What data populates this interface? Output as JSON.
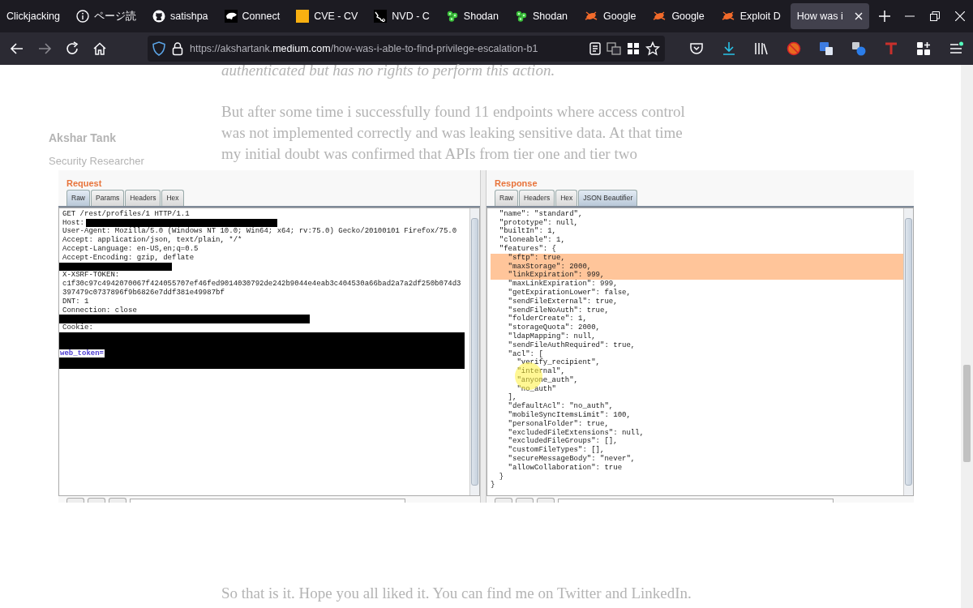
{
  "browser": {
    "tabs": [
      {
        "title": "Clickjacking",
        "kind": "plain",
        "selected": false
      },
      {
        "title": "ページ読",
        "kind": "info",
        "selected": false
      },
      {
        "title": "satishpa",
        "kind": "github",
        "selected": false
      },
      {
        "title": "Connect",
        "kind": "animal",
        "selected": false
      },
      {
        "title": "CVE - CV",
        "kind": "square",
        "selected": false
      },
      {
        "title": "NVD - C",
        "kind": "nvd",
        "selected": false
      },
      {
        "title": "Shodan",
        "kind": "dots",
        "selected": false
      },
      {
        "title": "Shodan",
        "kind": "dots",
        "selected": false
      },
      {
        "title": "Google",
        "kind": "bug",
        "selected": false
      },
      {
        "title": "Google",
        "kind": "bug",
        "selected": false
      },
      {
        "title": "Exploit D",
        "kind": "bug",
        "selected": false
      },
      {
        "title": "How was i",
        "kind": "plain",
        "selected": true
      }
    ],
    "nav_buttons": [
      {
        "kind": "back",
        "disabled": false
      },
      {
        "kind": "forward",
        "disabled": true
      },
      {
        "kind": "reload",
        "disabled": false
      },
      {
        "kind": "home",
        "disabled": false
      }
    ],
    "url": {
      "prefix": "https://akshartank.",
      "domain": "medium.com",
      "path": "/how-was-i-able-to-find-privilege-escalation-b1"
    },
    "menu_update_dot": true
  },
  "article": {
    "quote": "authenticated but has no rights to perform this action.",
    "author": {
      "name": "Akshar Tank",
      "role": "Security Researcher"
    },
    "paragraph_lines": [
      "But after some time i successfully found 11 endpoints where access control",
      "was not implemented correctly and was leaking sensitive data. At that time",
      "my initial doubt was confirmed that APIs from tier one and tier two"
    ],
    "closing": "So that is it. Hope you all liked it. You can find me on Twitter and LinkedIn."
  },
  "screenshot": {
    "request": {
      "title": "Request",
      "tabs": [
        {
          "label": "Raw",
          "selected": true
        },
        {
          "label": "Params",
          "selected": false
        },
        {
          "label": "Headers",
          "selected": false
        },
        {
          "label": "Hex",
          "selected": false
        }
      ],
      "lines": [
        {
          "kind": "text",
          "text": "GET /rest/profiles/1 HTTP/1.1"
        },
        {
          "kind": "text_redacted",
          "text": "Host:"
        },
        {
          "kind": "text",
          "text": "User-Agent: Mozilla/5.0 (Windows NT 10.0; Win64; x64; rv:75.0) Gecko/20100101 Firefox/75.0"
        },
        {
          "kind": "text",
          "text": "Accept: application/json, text/plain, */*"
        },
        {
          "kind": "text",
          "text": "Accept-Language: en-US,en;q=0.5"
        },
        {
          "kind": "text",
          "text": "Accept-Encoding: gzip, deflate"
        },
        {
          "kind": "redacted_short"
        },
        {
          "kind": "text",
          "text": "X-XSRF-TOKEN:"
        },
        {
          "kind": "text",
          "text": "c1f30c97c4942070067f424055707ef46fed9014030792de242b9044e4eab3c404530a66bad2a7a2df250b074d3"
        },
        {
          "kind": "text",
          "text": "397479c0737896f9b6826e7ddf381e49987bf"
        },
        {
          "kind": "text",
          "text": "DNT: 1"
        },
        {
          "kind": "text",
          "text": "Connection: close"
        },
        {
          "kind": "redacted_long"
        },
        {
          "kind": "text",
          "text": "Cookie:"
        },
        {
          "kind": "redacted_block",
          "text": "web_token="
        }
      ]
    },
    "response": {
      "title": "Response",
      "tabs": [
        {
          "label": "Raw",
          "selected": false
        },
        {
          "label": "Headers",
          "selected": false
        },
        {
          "label": "Hex",
          "selected": false
        },
        {
          "label": "JSON Beautifier",
          "selected": true
        }
      ],
      "lines": [
        {
          "text": "  \"name\": \"standard\",",
          "highlighted": false
        },
        {
          "text": "  \"prototype\": null,",
          "highlighted": false
        },
        {
          "text": "  \"builtIn\": 1,",
          "highlighted": false
        },
        {
          "text": "  \"cloneable\": 1,",
          "highlighted": false
        },
        {
          "text": "  \"features\": {",
          "highlighted": false
        },
        {
          "text": "    \"sftp\": true,",
          "highlighted": true
        },
        {
          "text": "    \"maxStorage\": 2000,",
          "highlighted": true
        },
        {
          "text": "    \"linkExpiration\": 999,",
          "highlighted": true
        },
        {
          "text": "    \"maxLinkExpiration\": 999,",
          "highlighted": false
        },
        {
          "text": "    \"getExpirationLower\": false,",
          "highlighted": false
        },
        {
          "text": "    \"sendFileExternal\": true,",
          "highlighted": false
        },
        {
          "text": "    \"sendFileNoAuth\": true,",
          "highlighted": false
        },
        {
          "text": "    \"folderCreate\": 1,",
          "highlighted": false
        },
        {
          "text": "    \"storageQuota\": 2000,",
          "highlighted": false
        },
        {
          "text": "    \"ldapMapping\": null,",
          "highlighted": false
        },
        {
          "text": "    \"sendFileAuthRequired\": true,",
          "highlighted": false
        },
        {
          "text": "    \"acl\": [",
          "highlighted": false
        },
        {
          "text": "      \"verify_recipient\",",
          "highlighted": false
        },
        {
          "text": "      \"internal\",",
          "highlighted": false,
          "cursor_spot": true
        },
        {
          "text": "      \"anyone_auth\",",
          "highlighted": false
        },
        {
          "text": "      \"no_auth\"",
          "highlighted": false
        },
        {
          "text": "    ],",
          "highlighted": false
        },
        {
          "text": "    \"defaultAcl\": \"no_auth\",",
          "highlighted": false
        },
        {
          "text": "    \"mobileSyncItemsLimit\": 100,",
          "highlighted": false
        },
        {
          "text": "    \"personalFolder\": true,",
          "highlighted": false
        },
        {
          "text": "    \"excludedFileExtensions\": null,",
          "highlighted": false
        },
        {
          "text": "    \"excludedFileGroups\": [],",
          "highlighted": false
        },
        {
          "text": "    \"customFileTypes\": [],",
          "highlighted": false
        },
        {
          "text": "    \"secureMessageBody\": \"never\",",
          "highlighted": false
        },
        {
          "text": "    \"allowCollaboration\": true",
          "highlighted": false
        },
        {
          "text": "  }",
          "highlighted": false
        },
        {
          "text": "}",
          "highlighted": false
        }
      ]
    }
  }
}
